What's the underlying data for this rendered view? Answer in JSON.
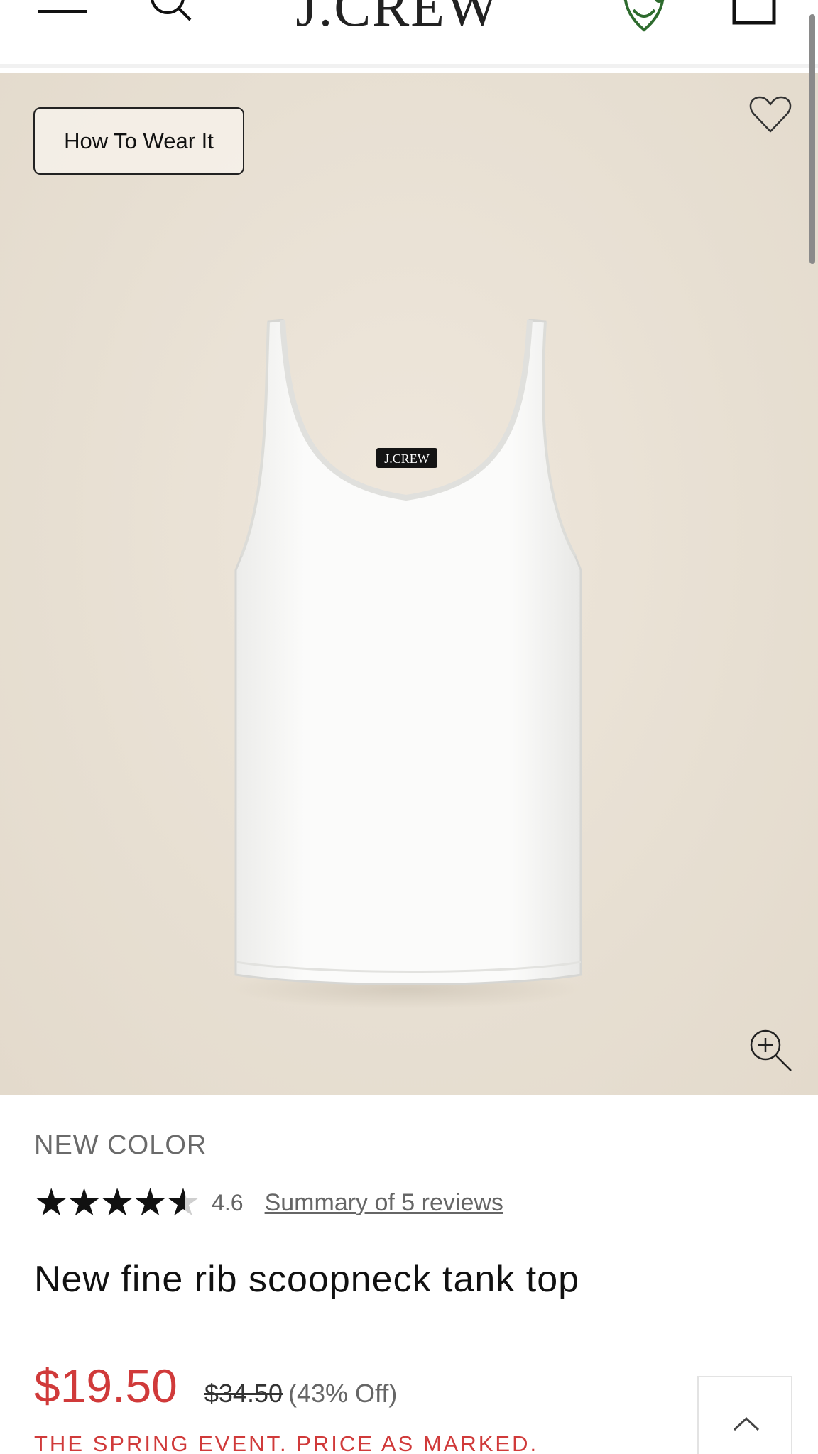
{
  "header": {
    "logo_text": "J.CREW",
    "icons": [
      "menu-icon",
      "search-icon",
      "account-icon",
      "bag-icon"
    ]
  },
  "hero": {
    "how_to_wear_label": "How To Wear It",
    "product_image_label": "J.CREW",
    "background_color": "#e8e0d3"
  },
  "product": {
    "badge": "NEW COLOR",
    "rating_value": "4.6",
    "rating_stars": 4.6,
    "reviews_link": "Summary of 5 reviews",
    "title": "New fine rib scoopneck tank top",
    "sale_price": "$19.50",
    "original_price": "$34.50",
    "discount": "(43% Off)",
    "promo": "THE SPRING EVENT. PRICE AS MARKED."
  },
  "colors": {
    "sale_red": "#d03a3a",
    "account_green": "#2e6b2e"
  }
}
